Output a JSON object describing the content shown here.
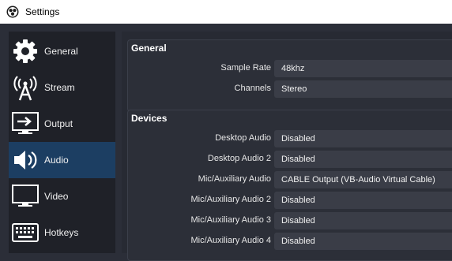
{
  "window": {
    "title": "Settings"
  },
  "sidebar": {
    "items": [
      {
        "label": "General",
        "icon": "gear-icon"
      },
      {
        "label": "Stream",
        "icon": "broadcast-antenna-icon"
      },
      {
        "label": "Output",
        "icon": "output-monitor-icon"
      },
      {
        "label": "Audio",
        "icon": "speaker-icon",
        "active": true
      },
      {
        "label": "Video",
        "icon": "monitor-icon"
      },
      {
        "label": "Hotkeys",
        "icon": "keyboard-icon"
      }
    ]
  },
  "general_group": {
    "title": "General",
    "rows": [
      {
        "label": "Sample Rate",
        "value": "48khz"
      },
      {
        "label": "Channels",
        "value": "Stereo"
      }
    ]
  },
  "devices_group": {
    "title": "Devices",
    "rows": [
      {
        "label": "Desktop Audio",
        "value": "Disabled"
      },
      {
        "label": "Desktop Audio 2",
        "value": "Disabled"
      },
      {
        "label": "Mic/Auxiliary Audio",
        "value": "CABLE Output (VB-Audio Virtual Cable)"
      },
      {
        "label": "Mic/Auxiliary Audio 2",
        "value": "Disabled"
      },
      {
        "label": "Mic/Auxiliary Audio 3",
        "value": "Disabled"
      },
      {
        "label": "Mic/Auxiliary Audio 4",
        "value": "Disabled"
      }
    ]
  },
  "colors": {
    "active_nav": "#1c3e62",
    "sidebar_bg": "#1f2128",
    "panel_bg": "#2c2f38",
    "field_bg": "#3a3d47"
  }
}
